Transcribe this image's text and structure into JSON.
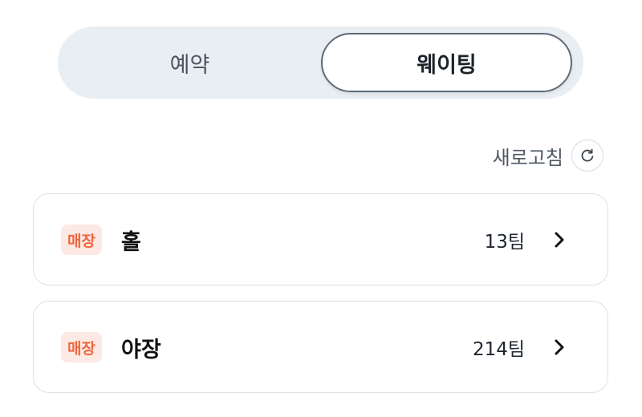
{
  "tabs": {
    "reservation_label": "예약",
    "waiting_label": "웨이팅",
    "selected": "waiting"
  },
  "refresh": {
    "label": "새로고침",
    "icon": "refresh-icon"
  },
  "areas": [
    {
      "badge": "매장",
      "name": "홀",
      "count": "13팀",
      "icon": "chevron-right-icon"
    },
    {
      "badge": "매장",
      "name": "야장",
      "count": "214팀",
      "icon": "chevron-right-icon"
    }
  ],
  "colors": {
    "badge_text": "#f0663f",
    "badge_bg": "#fde9e4",
    "segment_bg": "#e9eef3"
  }
}
